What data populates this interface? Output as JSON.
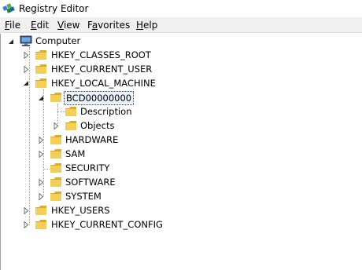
{
  "window": {
    "title": "Registry Editor",
    "app_icon": "registry-editor-icon"
  },
  "menu": [
    {
      "label": "File",
      "mnemonic": "F",
      "rest": "ile"
    },
    {
      "label": "Edit",
      "mnemonic": "E",
      "rest": "dit"
    },
    {
      "label": "View",
      "mnemonic": "V",
      "rest": "iew"
    },
    {
      "label": "Favorites",
      "mnemonic": "a",
      "pre": "F",
      "rest": "vorites"
    },
    {
      "label": "Help",
      "mnemonic": "H",
      "rest": "elp"
    }
  ],
  "tree": {
    "root": {
      "label": "Computer",
      "icon": "computer-icon",
      "expanded": true
    },
    "hives": [
      {
        "label": "HKEY_CLASSES_ROOT",
        "expanded": false
      },
      {
        "label": "HKEY_CURRENT_USER",
        "expanded": false
      },
      {
        "label": "HKEY_LOCAL_MACHINE",
        "expanded": true
      },
      {
        "label": "HKEY_USERS",
        "expanded": false
      },
      {
        "label": "HKEY_CURRENT_CONFIG",
        "expanded": false
      }
    ],
    "hklm_children": [
      {
        "label": "BCD00000000",
        "expanded": true,
        "selected": true
      },
      {
        "label": "HARDWARE",
        "expanded": false
      },
      {
        "label": "SAM",
        "expanded": false
      },
      {
        "label": "SECURITY",
        "expanded": false
      },
      {
        "label": "SOFTWARE",
        "expanded": false
      },
      {
        "label": "SYSTEM",
        "expanded": false
      }
    ],
    "bcd_children": [
      {
        "label": "Description",
        "expanded": null
      },
      {
        "label": "Objects",
        "expanded": false
      }
    ]
  },
  "colors": {
    "folder": "#f2cf5b",
    "folder_dark": "#d9ad2c",
    "selection_border": "#333333"
  }
}
